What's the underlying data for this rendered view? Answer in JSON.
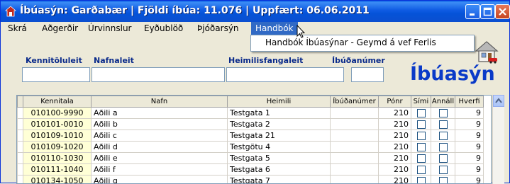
{
  "window": {
    "title": "Íbúasýn: Garðabær | Fjöldi íbúa: 11.076 | Uppfært: 06.06.2011"
  },
  "menu": {
    "items": [
      "Skrá",
      "Aðgerðir",
      "Úrvinnslur",
      "Eyðublöð",
      "Þjóðarsýn",
      "Handbók"
    ],
    "active": "Handbók",
    "dropdown_items": [
      "Handbók Íbúasýnar - Geymd á vef Ferlis"
    ]
  },
  "search": {
    "kennitala_label": "Kennitöluleit",
    "nafn_label": "Nafnaleit",
    "heimili_label": "Heimilisfangaleit",
    "ibud_label": "Íbúðanúmer"
  },
  "brand": {
    "text": "Íbúasýn"
  },
  "table": {
    "headers": [
      "Kennitala",
      "Nafn",
      "Heimili",
      "Íbúðanúmer",
      "Pónr",
      "Sími",
      "Annáll",
      "Hverfi"
    ],
    "rows": [
      [
        "010100-9990",
        "Aðili a",
        "Testgata 1",
        "",
        "210",
        "9"
      ],
      [
        "010101-0010",
        "Aðili b",
        "Testgata 2",
        "",
        "210",
        "9"
      ],
      [
        "010109-1010",
        "Aðili c",
        "Testgata 21",
        "",
        "210",
        "9"
      ],
      [
        "010109-1020",
        "Aðili d",
        "Testgötu 4",
        "",
        "210",
        "9"
      ],
      [
        "010110-1030",
        "Aðili e",
        "Testgata 5",
        "",
        "210",
        "9"
      ],
      [
        "010111-1040",
        "Aðili f",
        "Testgata 6",
        "",
        "210",
        "9"
      ],
      [
        "010134-1050",
        "Aðili g",
        "Testgata 7",
        "",
        "210",
        "9"
      ]
    ]
  }
}
